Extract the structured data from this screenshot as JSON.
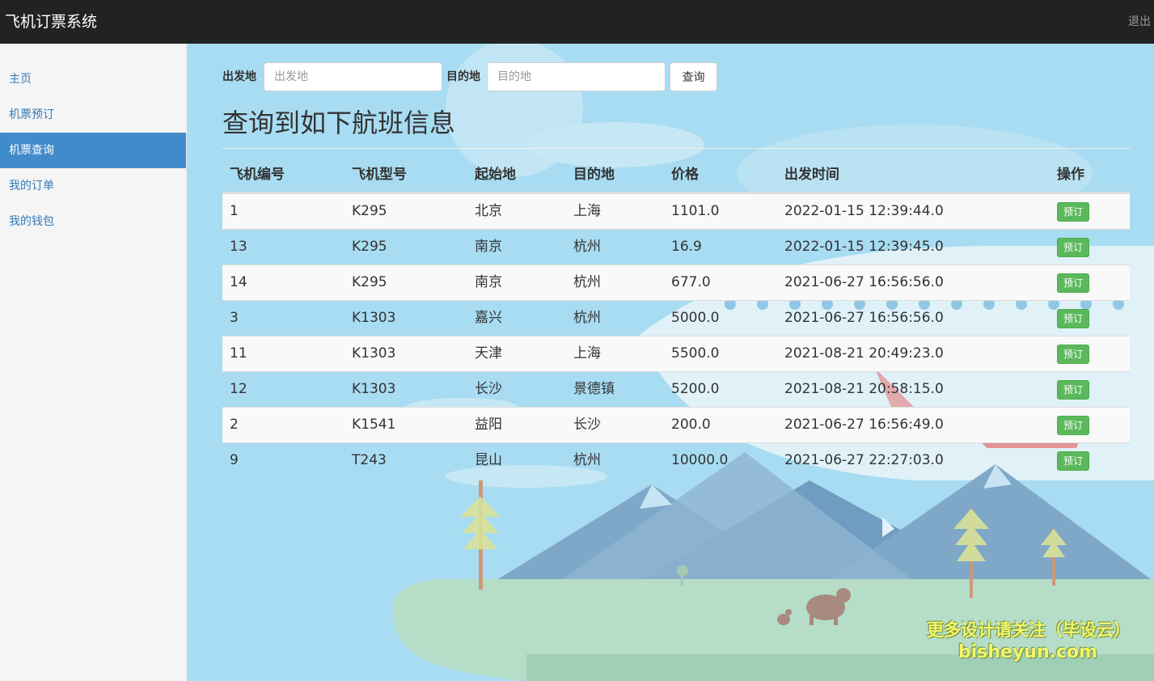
{
  "app": {
    "title": "飞机订票系统",
    "logout_label": "退出"
  },
  "sidebar": {
    "items": [
      {
        "label": "主页"
      },
      {
        "label": "机票预订"
      },
      {
        "label": "机票查询",
        "active": true
      },
      {
        "label": "我的订单"
      },
      {
        "label": "我的钱包"
      }
    ]
  },
  "search": {
    "from_label": "出发地",
    "from_placeholder": "出发地",
    "from_value": "",
    "to_label": "目的地",
    "to_placeholder": "目的地",
    "to_value": "",
    "button_label": "查询"
  },
  "results": {
    "heading": "查询到如下航班信息",
    "columns": [
      "飞机编号",
      "飞机型号",
      "起始地",
      "目的地",
      "价格",
      "出发时间",
      "操作"
    ],
    "action_label": "预订",
    "rows": [
      {
        "id": "1",
        "model": "K295",
        "from": "北京",
        "to": "上海",
        "price": "1101.0",
        "time": "2022-01-15 12:39:44.0"
      },
      {
        "id": "13",
        "model": "K295",
        "from": "南京",
        "to": "杭州",
        "price": "16.9",
        "time": "2022-01-15 12:39:45.0"
      },
      {
        "id": "14",
        "model": "K295",
        "from": "南京",
        "to": "杭州",
        "price": "677.0",
        "time": "2021-06-27 16:56:56.0"
      },
      {
        "id": "3",
        "model": "K1303",
        "from": "嘉兴",
        "to": "杭州",
        "price": "5000.0",
        "time": "2021-06-27 16:56:56.0"
      },
      {
        "id": "11",
        "model": "K1303",
        "from": "天津",
        "to": "上海",
        "price": "5500.0",
        "time": "2021-08-21 20:49:23.0"
      },
      {
        "id": "12",
        "model": "K1303",
        "from": "长沙",
        "to": "景德镇",
        "price": "5200.0",
        "time": "2021-08-21 20:58:15.0"
      },
      {
        "id": "2",
        "model": "K1541",
        "from": "益阳",
        "to": "长沙",
        "price": "200.0",
        "time": "2021-06-27 16:56:49.0"
      },
      {
        "id": "9",
        "model": "T243",
        "from": "昆山",
        "to": "杭州",
        "price": "10000.0",
        "time": "2021-06-27 22:27:03.0"
      }
    ]
  },
  "watermark": {
    "line1": "更多设计请关注（毕设云）",
    "line2": "bisheyun.com"
  },
  "colors": {
    "navbar": "#222222",
    "sidebar_active": "#428bca",
    "link": "#337ab7",
    "book_button": "#5cb85c",
    "background_sky": "#a8dcf2"
  }
}
